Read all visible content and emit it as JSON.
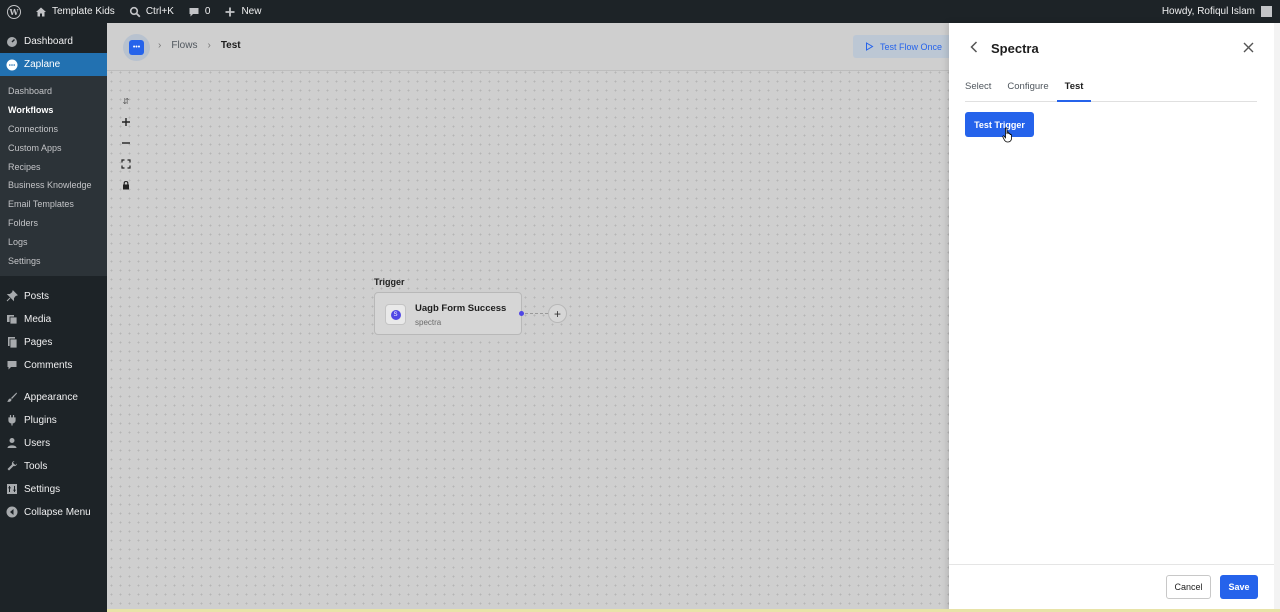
{
  "adminbar": {
    "site_name": "Template Kids",
    "search_shortcut": "Ctrl+K",
    "comments_count": "0",
    "new_label": "New",
    "greeting": "Howdy, Rofiqul Islam"
  },
  "sidebar": {
    "dashboard": "Dashboard",
    "plugin_menu": "Zaplane",
    "submenu": [
      "Dashboard",
      "Workflows",
      "Connections",
      "Custom Apps",
      "Recipes",
      "Business Knowledge",
      "Email Templates",
      "Folders",
      "Logs",
      "Settings"
    ],
    "current_submenu": "Workflows",
    "items": [
      "Posts",
      "Media",
      "Pages",
      "Comments",
      "Appearance",
      "Plugins",
      "Users",
      "Tools",
      "Settings",
      "Collapse Menu"
    ]
  },
  "canvas": {
    "breadcrumb": [
      "Flows",
      "Test"
    ],
    "test_flow_label": "Test Flow Once",
    "trigger_label": "Trigger",
    "node_title": "Uagb Form Success",
    "node_subtitle": "spectra"
  },
  "panel": {
    "title": "Spectra",
    "tabs": [
      "Select",
      "Configure",
      "Test"
    ],
    "active_tab": "Test",
    "test_trigger_label": "Test Trigger",
    "cancel_label": "Cancel",
    "save_label": "Save"
  },
  "colors": {
    "accent": "#2563eb",
    "admin_bar": "#1d2327",
    "menu_active": "#2271b1"
  }
}
